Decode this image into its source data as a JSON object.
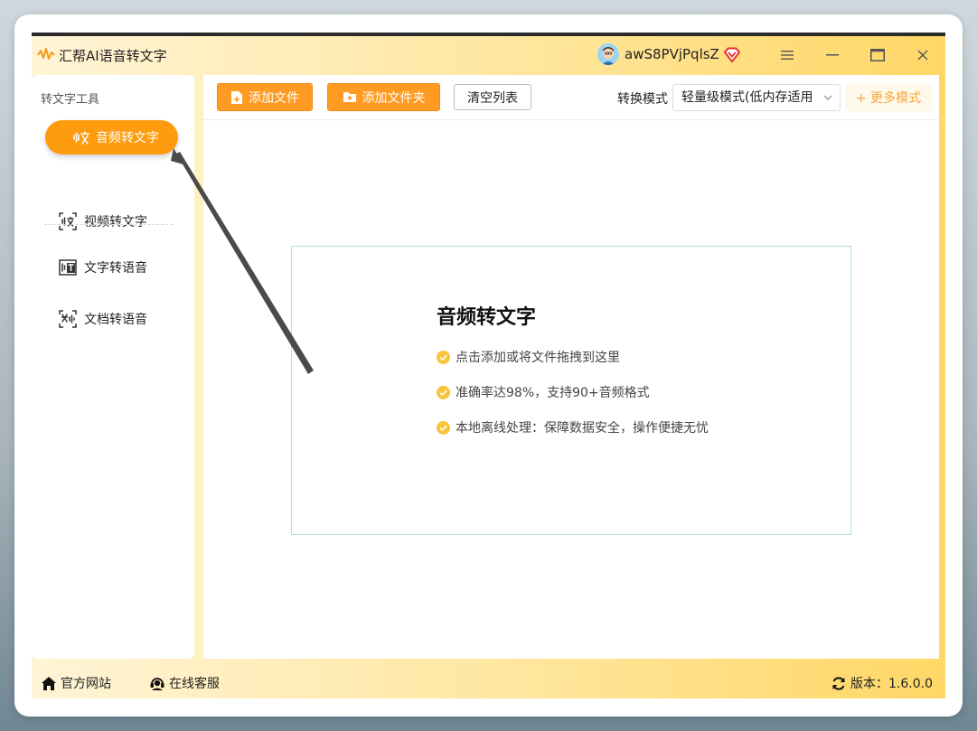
{
  "app": {
    "title": "汇帮AI语音转文字"
  },
  "user": {
    "name": "awS8PVjPqlsZ"
  },
  "window_controls": {
    "menu": "menu-icon",
    "minimize": "minimize-icon",
    "maximize": "maximize-icon",
    "close": "close-icon"
  },
  "sidebar": {
    "heading": "转文字工具",
    "items": [
      {
        "label": "音频转文字",
        "active": true
      },
      {
        "label": "视频转文字",
        "active": false
      },
      {
        "label": "文字转语音",
        "active": false
      },
      {
        "label": "文档转语音",
        "active": false
      }
    ]
  },
  "toolbar": {
    "add_file": "添加文件",
    "add_folder": "添加文件夹",
    "clear_list": "清空列表",
    "mode_label": "转换模式",
    "mode_value": "轻量级模式(低内存适用",
    "more_modes": "+ 更多模式"
  },
  "dropzone": {
    "title": "音频转文字",
    "features": [
      "点击添加或将文件拖拽到这里",
      "准确率达98%，支持90+音频格式",
      "本地离线处理：保障数据安全，操作便捷无忧"
    ]
  },
  "footer": {
    "website": "官方网站",
    "support": "在线客服",
    "version": "版本：1.6.0.0"
  },
  "colors": {
    "accent": "#ff9b0f",
    "check": "#f7c53a",
    "vip": "#e8322b"
  }
}
